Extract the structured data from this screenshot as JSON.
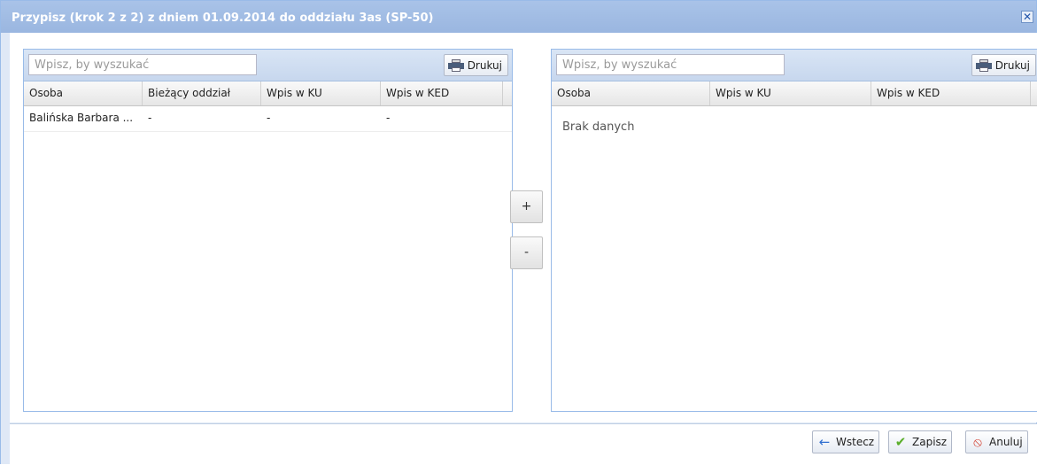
{
  "window": {
    "title": "Przypisz (krok 2 z 2) z dniem 01.09.2014 do oddziału 3as (SP-50)",
    "close_glyph": "✕"
  },
  "left_panel": {
    "search_placeholder": "Wpisz, by wyszukać",
    "print_label": "Drukuj",
    "columns": [
      "Osoba",
      "Bieżący oddział",
      "Wpis w KU",
      "Wpis w KED"
    ],
    "rows": [
      [
        "Balińska Barbara ...",
        "-",
        "-",
        "-"
      ]
    ]
  },
  "right_panel": {
    "search_placeholder": "Wpisz, by wyszukać",
    "print_label": "Drukuj",
    "columns": [
      "Osoba",
      "Wpis w KU",
      "Wpis w KED"
    ],
    "empty_text": "Brak danych"
  },
  "move": {
    "add_label": "+",
    "remove_label": "-"
  },
  "footer": {
    "back_label": "Wstecz",
    "save_label": "Zapisz",
    "cancel_label": "Anuluj"
  },
  "icons": {
    "print": "printer-icon",
    "back": "arrow-left-icon",
    "save": "checkmark-icon",
    "cancel": "cancel-icon"
  },
  "colors": {
    "title_bar": "#9ab6e0",
    "panel_border": "#99bbe8",
    "back_arrow": "#2f6fd0",
    "save_check": "#5aae2a",
    "cancel": "#d23a2a"
  }
}
